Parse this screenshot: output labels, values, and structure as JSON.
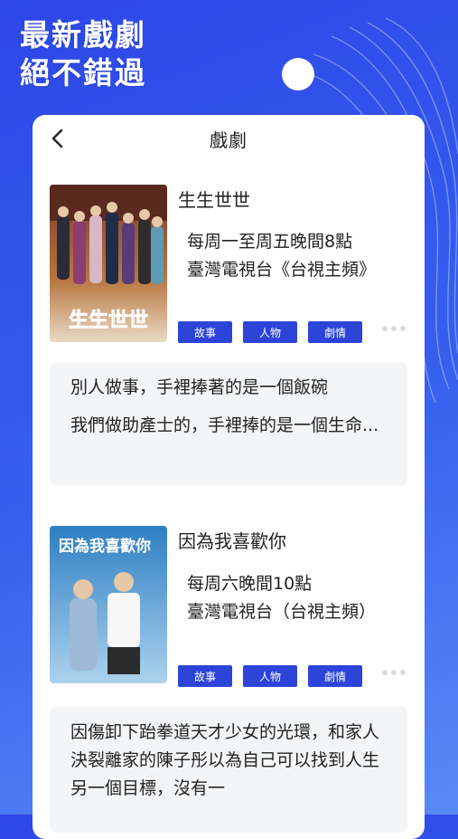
{
  "promo": {
    "line1": "最新戲劇",
    "line2": "絕不錯過"
  },
  "header": {
    "title": "戲劇",
    "back_icon": "chevron-left-icon"
  },
  "shows": [
    {
      "title": "生生世世",
      "schedule_line1": "每周一至周五晚間8點",
      "schedule_line2": "臺灣電視台《台視主頻》",
      "tags": [
        "故事",
        "人物",
        "劇情"
      ],
      "quote_p1": "別人做事，手裡捧著的是一個飯碗",
      "quote_p2": "我們做助產士的，手裡捧的是一個生命...",
      "poster_title": "生生世世"
    },
    {
      "title": "因為我喜歡你",
      "schedule_line1": "每周六晚間10點",
      "schedule_line2": "臺灣電視台（台視主頻）",
      "tags": [
        "故事",
        "人物",
        "劇情"
      ],
      "quote_p1": "因傷卸下跆拳道天才少女的光環，和家人決裂離家的陳子彤以為自己可以找到人生另一個目標，沒有一",
      "poster_title": "因為我喜歡你"
    }
  ],
  "colors": {
    "accent": "#2d44d9",
    "background": "#3660ee"
  }
}
